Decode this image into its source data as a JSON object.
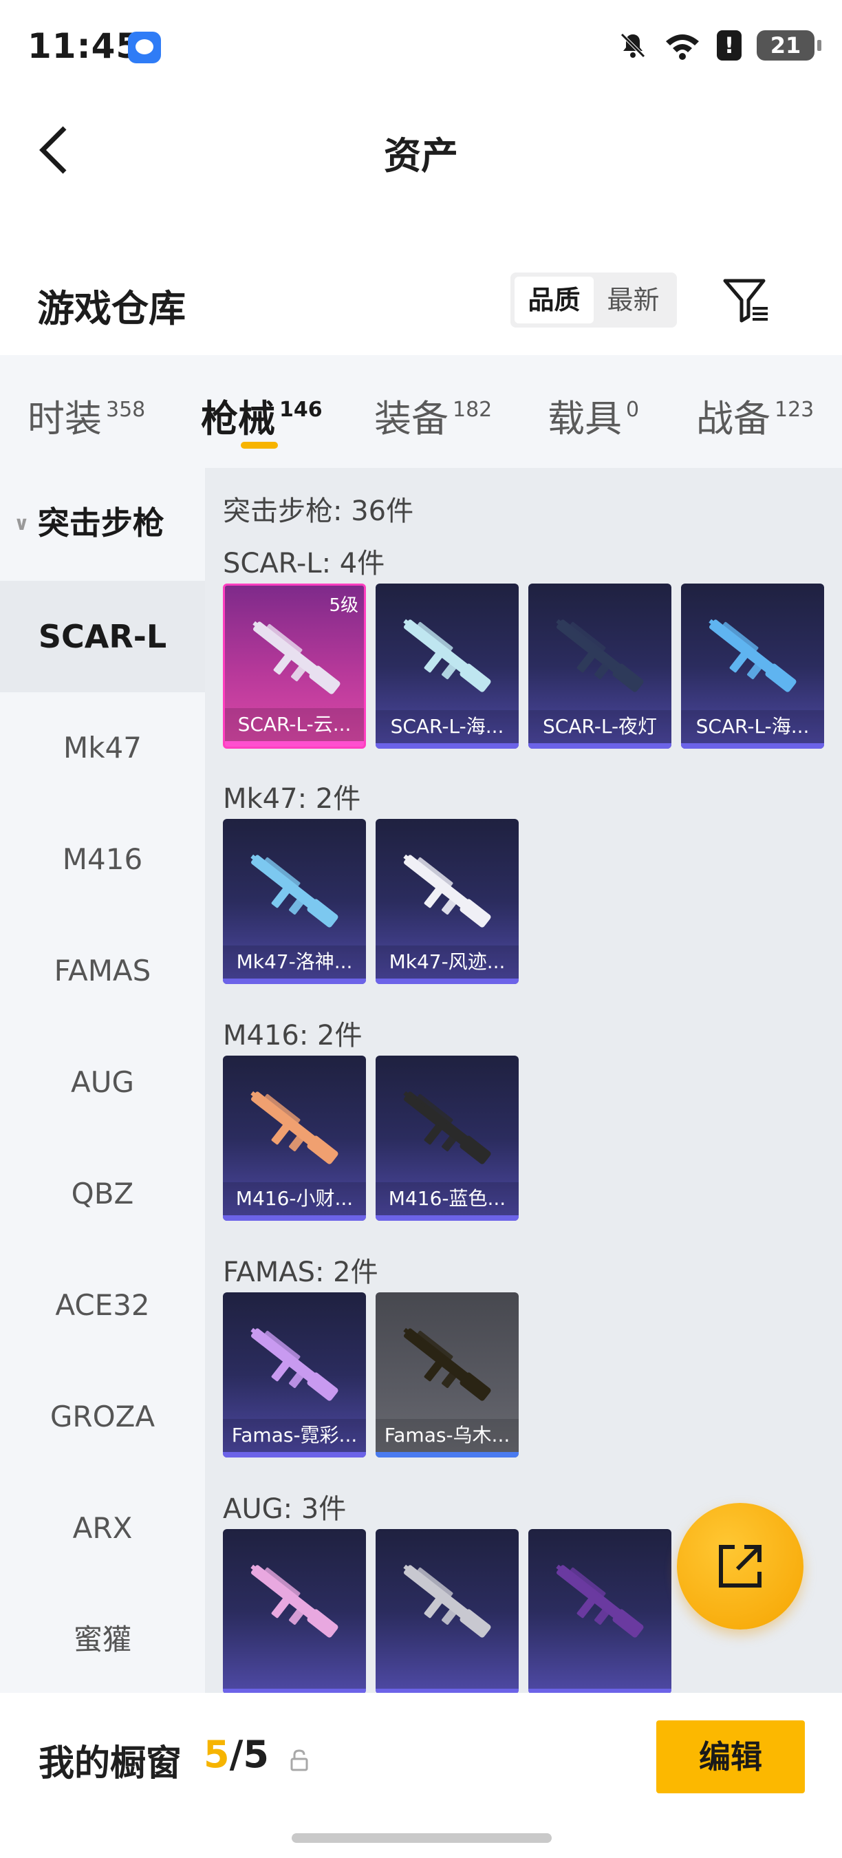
{
  "status_bar": {
    "time": "11:45",
    "battery": "21"
  },
  "header": {
    "title": "资产"
  },
  "warehouse": {
    "title": "游戏仓库",
    "sort_options": [
      "品质",
      "最新"
    ]
  },
  "category_tabs": [
    {
      "label": "时装",
      "count": "358"
    },
    {
      "label": "枪械",
      "count": "146"
    },
    {
      "label": "装备",
      "count": "182"
    },
    {
      "label": "载具",
      "count": "0"
    },
    {
      "label": "战备",
      "count": "123"
    }
  ],
  "sidebar": {
    "group": "突击步枪",
    "items": [
      "SCAR-L",
      "Mk47",
      "M416",
      "FAMAS",
      "AUG",
      "QBZ",
      "ACE32",
      "GROZA",
      "ARX",
      "蜜獾"
    ]
  },
  "content": {
    "total_label": "突击步枪: 36件",
    "sections": [
      {
        "label": "SCAR-L: 4件",
        "cards": [
          {
            "name": "SCAR-L-云...",
            "level": "5级",
            "style": "pink",
            "gun_color": "#e8e0f0"
          },
          {
            "name": "SCAR-L-海...",
            "style": "purple",
            "gun_color": "#bfe6f0"
          },
          {
            "name": "SCAR-L-夜灯",
            "style": "purple",
            "gun_color": "#2e3a5a"
          },
          {
            "name": "SCAR-L-海...",
            "style": "purple",
            "gun_color": "#5fb4f0"
          }
        ]
      },
      {
        "label": "Mk47: 2件",
        "cards": [
          {
            "name": "Mk47-洛神...",
            "style": "purple",
            "gun_color": "#7cc8f0"
          },
          {
            "name": "Mk47-风迹...",
            "style": "purple",
            "gun_color": "#f0f0f6"
          }
        ]
      },
      {
        "label": "M416: 2件",
        "cards": [
          {
            "name": "M416-小财...",
            "style": "purple",
            "gun_color": "#f0a070"
          },
          {
            "name": "M416-蓝色...",
            "style": "purple",
            "gun_color": "#2a2a2a"
          }
        ]
      },
      {
        "label": "FAMAS: 2件",
        "cards": [
          {
            "name": "Famas-霓彩...",
            "style": "purple",
            "gun_color": "#c89af0"
          },
          {
            "name": "Famas-乌木...",
            "style": "gray",
            "gun_color": "#2a2414"
          }
        ]
      },
      {
        "label": "AUG: 3件",
        "cards": [
          {
            "name": "",
            "style": "purple",
            "gun_color": "#e8a8e0"
          },
          {
            "name": "",
            "style": "purple",
            "gun_color": "#c8c8d0"
          },
          {
            "name": "",
            "style": "purple",
            "gun_color": "#6a3aa0"
          }
        ]
      }
    ]
  },
  "bottom_bar": {
    "title": "我的橱窗",
    "current": "5",
    "separator": "/",
    "max": "5",
    "edit_label": "编辑"
  },
  "colors": {
    "accent": "#f7b400",
    "pink_frame": "#ff3fc0",
    "purple_bar": "#6c63e8"
  }
}
